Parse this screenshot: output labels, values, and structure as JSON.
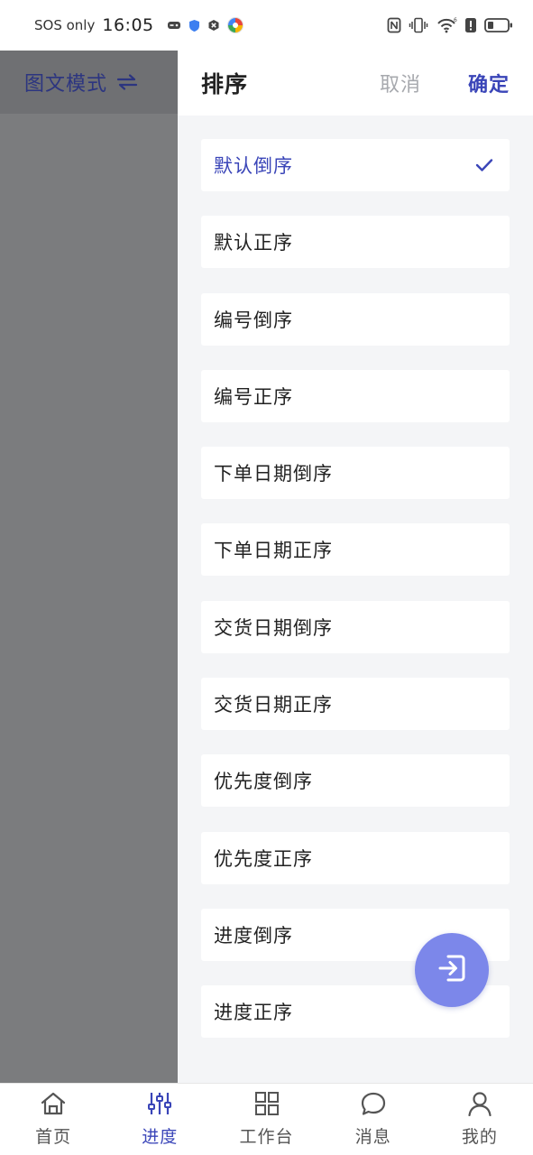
{
  "status_bar": {
    "sos": "SOS only",
    "time": "16:05"
  },
  "left": {
    "mode_label": "图文模式"
  },
  "panel": {
    "title": "排序",
    "cancel": "取消",
    "confirm": "确定",
    "items": [
      {
        "label": "默认倒序",
        "selected": true
      },
      {
        "label": "默认正序",
        "selected": false
      },
      {
        "label": "编号倒序",
        "selected": false
      },
      {
        "label": "编号正序",
        "selected": false
      },
      {
        "label": "下单日期倒序",
        "selected": false
      },
      {
        "label": "下单日期正序",
        "selected": false
      },
      {
        "label": "交货日期倒序",
        "selected": false
      },
      {
        "label": "交货日期正序",
        "selected": false
      },
      {
        "label": "优先度倒序",
        "selected": false
      },
      {
        "label": "优先度正序",
        "selected": false
      },
      {
        "label": "进度倒序",
        "selected": false
      },
      {
        "label": "进度正序",
        "selected": false
      }
    ]
  },
  "bottom_nav": {
    "items": [
      {
        "label": "首页",
        "icon": "home-icon",
        "active": false
      },
      {
        "label": "进度",
        "icon": "sliders-icon",
        "active": true
      },
      {
        "label": "工作台",
        "icon": "grid-icon",
        "active": false
      },
      {
        "label": "消息",
        "icon": "chat-icon",
        "active": false
      },
      {
        "label": "我的",
        "icon": "user-icon",
        "active": false
      }
    ]
  },
  "colors": {
    "accent": "#3a45b8",
    "fab": "#7c87ea",
    "overlay": "#7b7c7e",
    "muted": "#a7a9ae"
  }
}
